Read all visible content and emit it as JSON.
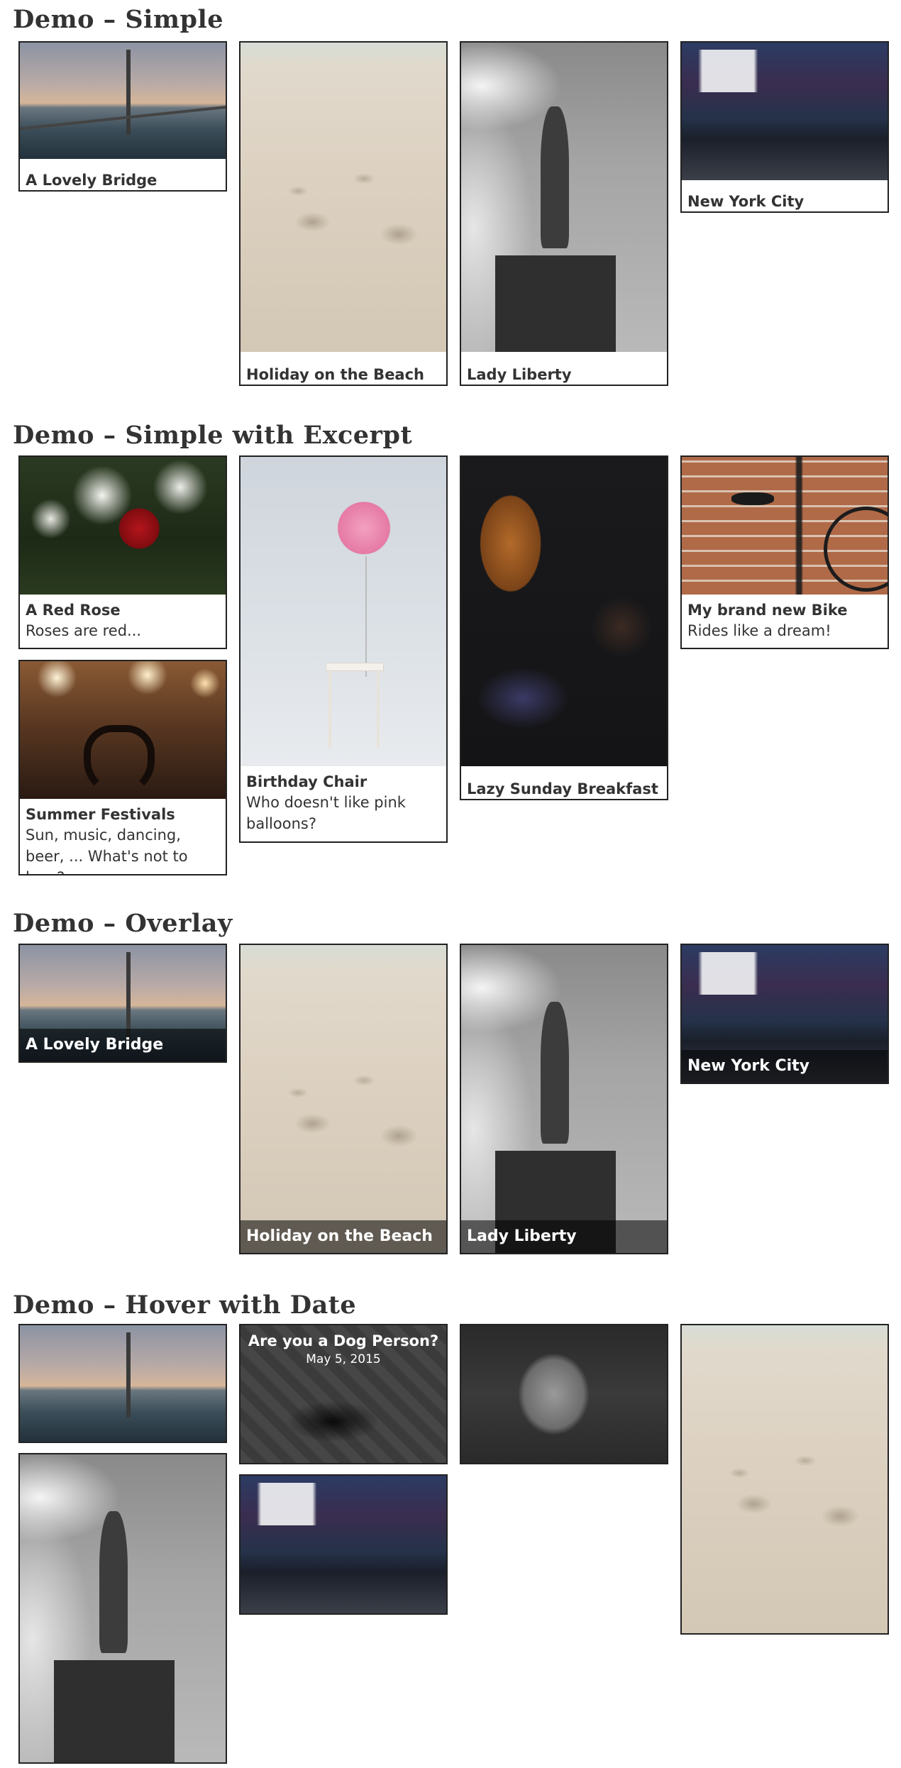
{
  "sections": {
    "simple": {
      "heading": "Demo – Simple",
      "cards": [
        {
          "title": "A Lovely Bridge",
          "image_icon": "bridge-photo"
        },
        {
          "title": "Holiday on the Beach",
          "image_icon": "beach-footprints-photo"
        },
        {
          "title": "Lady Liberty",
          "image_icon": "statue-of-liberty-photo"
        },
        {
          "title": "New York City",
          "image_icon": "times-square-photo"
        }
      ]
    },
    "excerpt": {
      "heading": "Demo – Simple with Excerpt",
      "cards": [
        {
          "title": "A Red Rose",
          "excerpt": "Roses are red...",
          "image_icon": "red-rose-photo"
        },
        {
          "title": "Birthday Chair",
          "excerpt": "Who doesn't like pink balloons?",
          "image_icon": "balloon-chair-photo"
        },
        {
          "title": "Lazy Sunday Breakfast",
          "excerpt": "",
          "image_icon": "breakfast-photo"
        },
        {
          "title": "My brand new Bike",
          "excerpt": "Rides like a dream!",
          "image_icon": "bike-photo"
        },
        {
          "title": "Summer Festivals",
          "excerpt": "Sun, music, dancing, beer, ... What's not to love?",
          "image_icon": "concert-photo"
        }
      ]
    },
    "overlay": {
      "heading": "Demo – Overlay",
      "cards": [
        {
          "title": "A Lovely Bridge",
          "image_icon": "bridge-photo"
        },
        {
          "title": "Holiday on the Beach",
          "image_icon": "beach-footprints-photo"
        },
        {
          "title": "Lady Liberty",
          "image_icon": "statue-of-liberty-photo"
        },
        {
          "title": "New York City",
          "image_icon": "times-square-photo"
        }
      ]
    },
    "hover": {
      "heading": "Demo – Hover with Date",
      "cards": [
        {
          "image_icon": "bridge-photo"
        },
        {
          "title": "Are you a Dog Person?",
          "date": "May 5, 2015",
          "image_icon": "dog-photo"
        },
        {
          "image_icon": "cat-photo"
        },
        {
          "image_icon": "beach-footprints-photo"
        },
        {
          "image_icon": "statue-of-liberty-photo"
        },
        {
          "image_icon": "times-square-photo"
        }
      ]
    }
  },
  "colors": {
    "text": "#333333",
    "border": "#222222",
    "overlay": "rgba(0,0,0,0.55)"
  }
}
